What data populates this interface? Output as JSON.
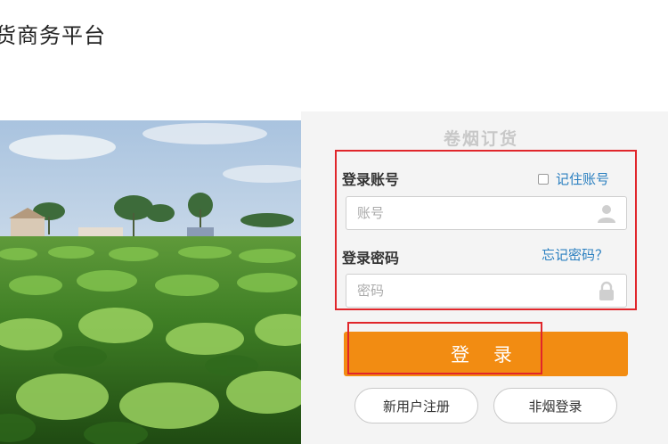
{
  "header": {
    "title": "货商务平台"
  },
  "login_form": {
    "heading": "卷烟订货",
    "account_label": "登录账号",
    "remember_label": "记住账号",
    "account_placeholder": "账号",
    "password_label": "登录密码",
    "forgot_label": "忘记密码？",
    "password_placeholder": "密码",
    "login_button": "登 录",
    "register_button": "新用户注册",
    "non_tobacco_button": "非烟登录"
  },
  "colors": {
    "accent_orange": "#f28c12",
    "highlight_red": "#e0262b",
    "link_blue": "#2a7fc0"
  },
  "icons": {
    "account_icon": "user-icon",
    "password_icon": "lock-icon"
  }
}
